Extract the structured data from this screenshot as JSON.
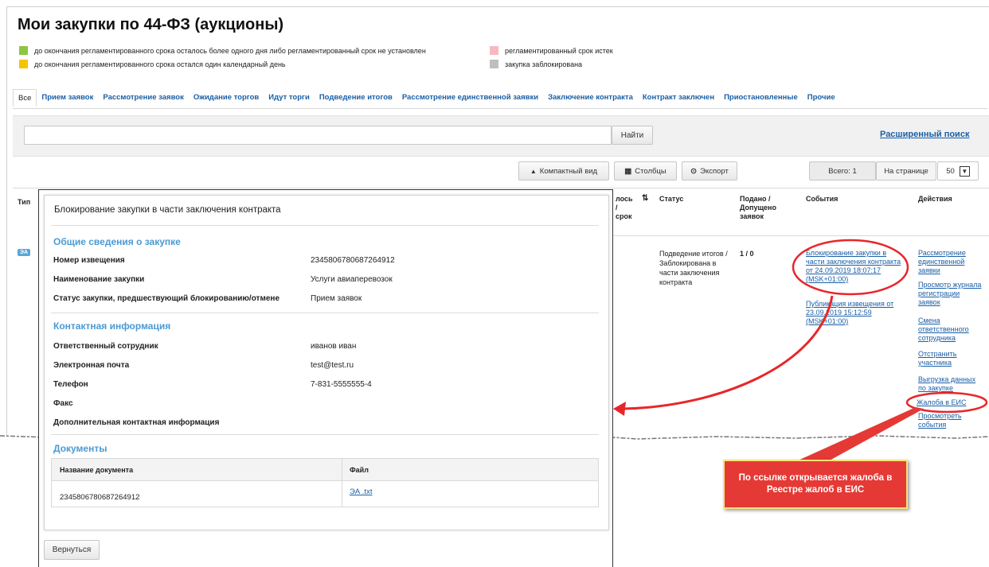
{
  "page": {
    "title": "Мои закупки по 44-ФЗ (аукционы)"
  },
  "legend": [
    {
      "text": "до окончания регламентированного срока осталось более одного дня либо регламентированный срок не установлен",
      "color": "#8dc63f"
    },
    {
      "text": "до окончания регламентированного срока остался один календарный день",
      "color": "#f5c400"
    },
    {
      "text": "регламентированный срок истек",
      "color": "#f7b9bf"
    },
    {
      "text": "закупка заблокирована",
      "color": "#bfbfbf"
    }
  ],
  "tabs": [
    "Все",
    "Прием заявок",
    "Рассмотрение заявок",
    "Ожидание торгов",
    "Идут торги",
    "Подведение итогов",
    "Рассмотрение единственной заявки",
    "Заключение контракта",
    "Контракт заключен",
    "Приостановленные",
    "Прочие"
  ],
  "search": {
    "button": "Найти",
    "advanced": "Расширенный поиск"
  },
  "toolbar": {
    "compact": "Компактный вид",
    "columns": "Столбцы",
    "export": "Экспорт",
    "total": "Всего: 1",
    "per_page_label": "На странице",
    "per_page_value": "50"
  },
  "table": {
    "headers": {
      "type": "Тип",
      "partial1": "лось",
      "partial2": "/",
      "partial3": "срок",
      "status": "Статус",
      "submitted": "Подано / Допущено заявок",
      "events": "События",
      "actions": "Действия"
    },
    "row": {
      "type_badge": "ЭА",
      "status": "Подведение итогов / Заблокирована в части заключения контракта",
      "submitted": "1 / 0",
      "events": [
        "Блокирование закупки в части заключения контракта от 24.09.2019 18:07:17 (MSK+01:00)",
        "Публикация извещения от 23.09.2019 15:12:59 (MSK+01:00)"
      ],
      "actions": [
        "Рассмотрение единственной заявки",
        "Просмотр журнала регистрации заявок",
        "Смена ответственного сотрудника",
        "Отстранить участника",
        "Выгрузка данных по закупке",
        "Жалоба в ЕИС",
        "Просмотреть события"
      ]
    }
  },
  "modal": {
    "title": "Блокирование закупки в части заключения контракта",
    "general_section": "Общие сведения о закупке",
    "general": [
      {
        "label": "Номер извещения",
        "value": "2345806780687264912"
      },
      {
        "label": "Наименование закупки",
        "value": "Услуги авиаперевозок"
      },
      {
        "label": "Статус закупки, предшествующий блокированию/отмене",
        "value": "Прием заявок"
      }
    ],
    "contact_section": "Контактная информация",
    "contact": [
      {
        "label": "Ответственный сотрудник",
        "value": "иванов иван"
      },
      {
        "label": "Электронная почта",
        "value": "test@test.ru"
      },
      {
        "label": "Телефон",
        "value": "7-831-5555555-4"
      },
      {
        "label": "Факс",
        "value": ""
      },
      {
        "label": "Дополнительная контактная информация",
        "value": ""
      }
    ],
    "docs_section": "Документы",
    "docs_headers": [
      "Название документа",
      "Файл"
    ],
    "docs_rows": [
      {
        "name": "2345806780687264912",
        "file": "ЭА .txt"
      }
    ],
    "back_button": "Вернуться"
  },
  "callout": {
    "text": "По ссылке открывается жалоба в Реестре жалоб в ЕИС"
  }
}
